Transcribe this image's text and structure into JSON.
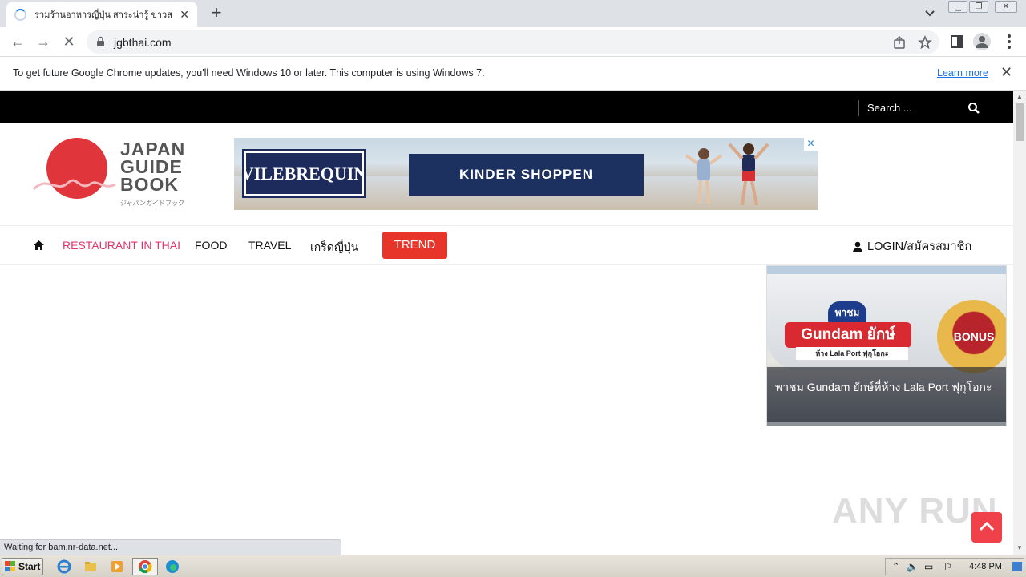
{
  "browser": {
    "tab_title": "รวมร้านอาหารญี่ปุ่น สาระน่ารู้ ข่าวสาร ส",
    "new_tab_label": "+",
    "url": "jgbthai.com",
    "window_buttons": [
      "minimize",
      "restore",
      "close"
    ]
  },
  "infobar": {
    "message": "To get future Google Chrome updates, you'll need Windows 10 or later. This computer is using Windows 7.",
    "link": "Learn more"
  },
  "site": {
    "search_placeholder": "Search ...",
    "logo_lines": [
      "JAPAN",
      "GUIDE",
      "BOOK"
    ],
    "logo_kana": "ジャパンガイドブック",
    "ad": {
      "brand": "VILEBREQUIN",
      "cta": "KINDER SHOPPEN"
    },
    "nav": {
      "items": [
        "RESTAURANT IN THAI",
        "FOOD",
        "TRAVEL",
        "เกร็ดญี่ปุ่น"
      ],
      "trend": "TREND",
      "login": "LOGIN/สมัครสมาชิก"
    },
    "sidecard": {
      "tag1": "พาชม",
      "tag2": "Gundam ยักษ์",
      "tag3": "ห้าง Lala Port ฟุกุโอกะ",
      "badge": "BONUS",
      "caption": "พาชม Gundam ยักษ์ที่ห้าง Lala Port ฟุกุโอกะ"
    },
    "watermark": "ANY RUN"
  },
  "status_bar": "Waiting for bam.nr-data.net...",
  "taskbar": {
    "start": "Start",
    "clock": "4:48 PM"
  },
  "colors": {
    "brand_red": "#e0353a",
    "nav_active": "#e0356b",
    "trend_bg": "#e8352a",
    "link_blue": "#1a73e8"
  }
}
